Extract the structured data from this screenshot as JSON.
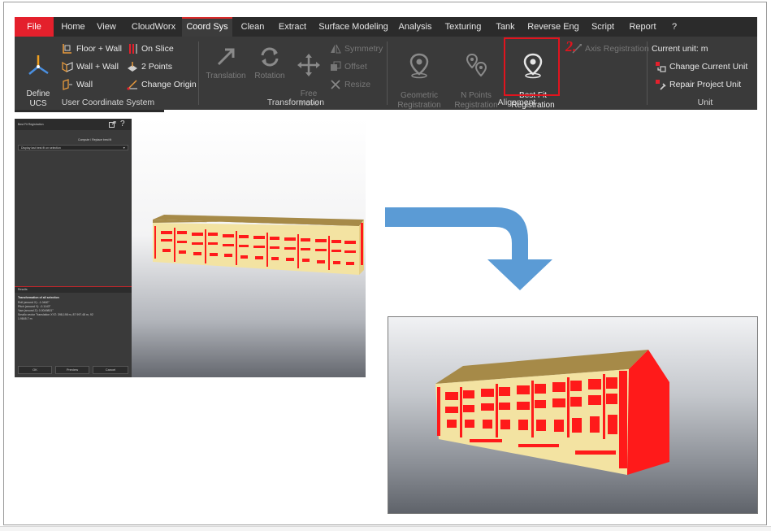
{
  "ribbon": {
    "tabs": [
      "File",
      "Home",
      "View",
      "CloudWorx",
      "Coord Sys",
      "Clean",
      "Extract",
      "Surface Modeling",
      "Analysis",
      "Texturing",
      "Tank",
      "Reverse Eng",
      "Script",
      "Report",
      "?"
    ],
    "active_tab": "Coord Sys",
    "ucs_group": {
      "define_ucs": "Define\nUCS",
      "floor_wall": "Floor + Wall",
      "wall_wall": "Wall + Wall",
      "wall": "Wall",
      "on_slice": "On Slice",
      "two_points": "2 Points",
      "change_origin": "Change Origin",
      "label": "User Coordinate System"
    },
    "transformation_group": {
      "translation": "Translation",
      "rotation": "Rotation",
      "free_move": "Free\nMove",
      "symmetry": "Symmetry",
      "offset": "Offset",
      "resize": "Resize",
      "label": "Transformation"
    },
    "alignment_group": {
      "geometric": "Geometric\nRegistration",
      "n_points": "N Points\nRegistration",
      "best_fit": "Best Fit\nRegistration",
      "axis": "Axis Registration",
      "label": "Alignment"
    },
    "unit_group": {
      "current_unit": "Current unit: m",
      "change_current_unit": "Change Current Unit",
      "repair_project_unit": "Repair Project Unit",
      "label": "Unit"
    },
    "annotation": "2."
  },
  "left_panel": {
    "title": "Best Fit Registration",
    "option_label": "Compute / Replace best fit",
    "dropdown_value": "Display last best fit on selection",
    "results_title": "Results",
    "results_heading": "Transformation of all selection",
    "results_lines": [
      "Roll (around X): -1.0460°",
      "Pitch (around Y): -0.1143°",
      "Yaw (around Z): 0.0049801°",
      "Smallo vector Translation XYZ: 398,198 m, 87 997.48 m, 92",
      "1.9845.7 m"
    ],
    "buttons": [
      "OK",
      "Preview",
      "Cancel"
    ]
  },
  "colors": {
    "accent_red": "#e0141e",
    "ribbon_bg": "#3a3a3a",
    "arrow_blue": "#5b9bd5",
    "building_red": "#ff1a1a",
    "building_cream": "#f3e3a2",
    "roof_tan": "#a68a48"
  }
}
